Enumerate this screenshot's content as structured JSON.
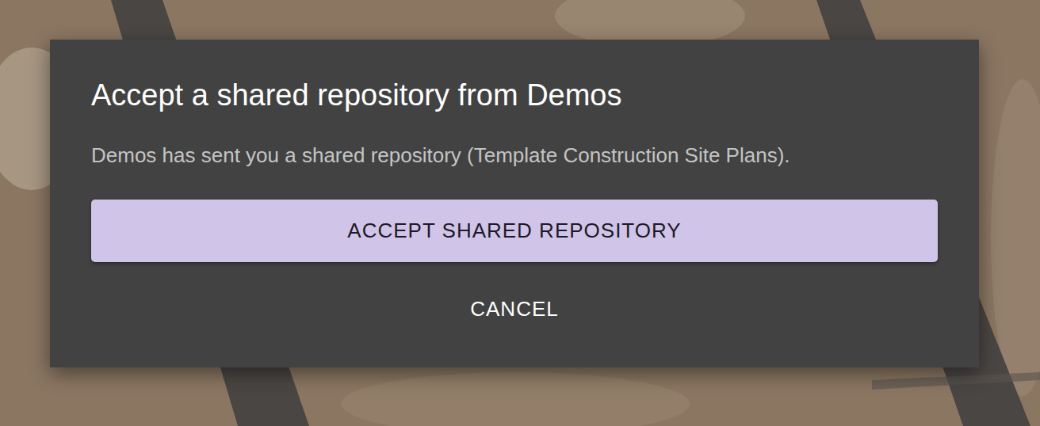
{
  "dialog": {
    "title": "Accept a shared repository from Demos",
    "message": "Demos has sent you a shared repository (Template Construction Site Plans).",
    "buttons": [
      {
        "label": "ACCEPT SHARED REPOSITORY",
        "kind": "primary"
      },
      {
        "label": "CANCEL",
        "kind": "text"
      }
    ]
  }
}
